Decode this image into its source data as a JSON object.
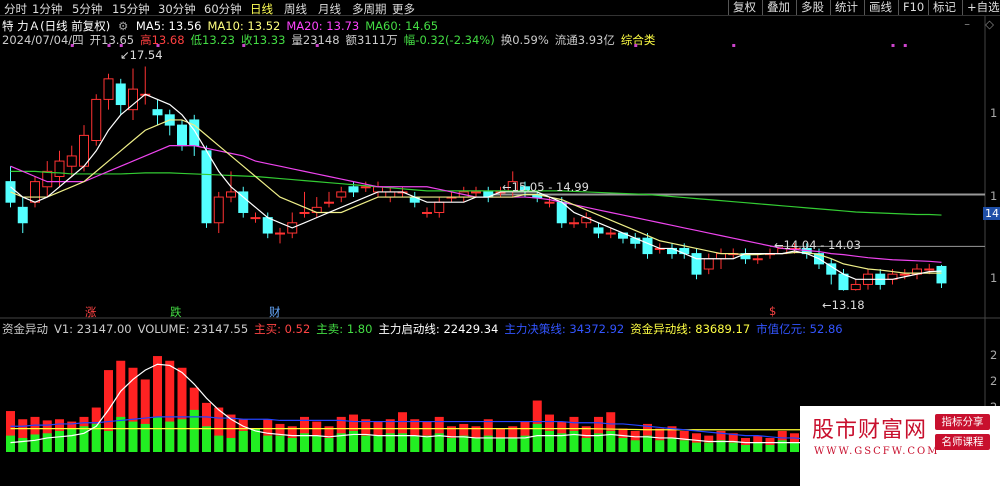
{
  "toolbar": {
    "periods": [
      "分时",
      "1分钟",
      "5分钟",
      "15分钟",
      "30分钟",
      "60分钟",
      "日线",
      "周线",
      "月线",
      "多周期",
      "更多"
    ],
    "active_period": "日线",
    "right_buttons": [
      "复权",
      "叠加",
      "多股",
      "统计",
      "画线",
      "F10",
      "标记",
      "+自选"
    ]
  },
  "main_panel": {
    "stock_title": "特 力Ａ(日线 前复权)",
    "ma_labels": [
      {
        "text": "MA5: 13.56",
        "color": "#ffffff"
      },
      {
        "text": "MA10: 13.52",
        "color": "#ffff7f"
      },
      {
        "text": "MA20: 13.73",
        "color": "#ff44ff"
      },
      {
        "text": "MA60: 14.65",
        "color": "#44dd44"
      }
    ],
    "quote_line": [
      {
        "text": "2024/07/04/四",
        "color": "#cccccc"
      },
      {
        "text": "开13.65",
        "color": "#cccccc"
      },
      {
        "text": "高13.68",
        "color": "#ff4040"
      },
      {
        "text": "低13.23",
        "color": "#44dd44"
      },
      {
        "text": "收13.33",
        "color": "#44dd44"
      },
      {
        "text": "量23148",
        "color": "#cccccc"
      },
      {
        "text": "额3111万",
        "color": "#cccccc"
      },
      {
        "text": "幅-0.32(-2.34%)",
        "color": "#44dd44"
      },
      {
        "text": "换0.59%",
        "color": "#cccccc"
      },
      {
        "text": "流通3.93亿",
        "color": "#cccccc"
      },
      {
        "text": "综合类",
        "color": "#ffff44"
      }
    ],
    "annotations": {
      "high": "17.54",
      "low": "13.18",
      "range1": "15.05 - 14.99",
      "range2": "14.04 - 14.03"
    },
    "right_price_tag": "14.",
    "axis_ticks": [
      "1",
      "1",
      "1"
    ],
    "event_markers": [
      {
        "text": "涨",
        "color": "#ff4444"
      },
      {
        "text": "跌",
        "color": "#44dd44"
      },
      {
        "text": "财",
        "color": "#66aaff"
      },
      {
        "text": "$",
        "color": "#ff4444"
      }
    ]
  },
  "sub_panel": {
    "labels": [
      {
        "text": "资金异动",
        "color": "#cccccc"
      },
      {
        "text": "V1: 23147.00",
        "color": "#cccccc"
      },
      {
        "text": "VOLUME: 23147.55",
        "color": "#cccccc"
      },
      {
        "text": "主买: 0.52",
        "color": "#ff4444"
      },
      {
        "text": "主卖: 1.80",
        "color": "#44dd44"
      },
      {
        "text": "主力启动线: 22429.34",
        "color": "#ffffff"
      },
      {
        "text": "主力决策线: 34372.92",
        "color": "#3355ff"
      },
      {
        "text": "资金异动线: 83689.17",
        "color": "#ffff44"
      },
      {
        "text": "市值亿元: 52.86",
        "color": "#3355ff"
      }
    ],
    "axis_ticks": [
      "2",
      "2",
      "2",
      "1"
    ]
  },
  "watermark": {
    "brand": "股市财富网",
    "url": "WWW.GSCFW.COM",
    "tag1": "指标分享",
    "tag2": "名师课程"
  },
  "chart_data": {
    "type": "candlestick",
    "candles": [
      {
        "o": 15.3,
        "c": 14.9,
        "h": 15.6,
        "l": 14.8
      },
      {
        "o": 14.8,
        "c": 14.5,
        "h": 15.0,
        "l": 14.3
      },
      {
        "o": 14.9,
        "c": 15.3,
        "h": 15.4,
        "l": 14.8
      },
      {
        "o": 15.2,
        "c": 15.5,
        "h": 15.7,
        "l": 15.0
      },
      {
        "o": 15.4,
        "c": 15.7,
        "h": 15.9,
        "l": 15.2
      },
      {
        "o": 15.6,
        "c": 15.8,
        "h": 16.0,
        "l": 15.4
      },
      {
        "o": 15.6,
        "c": 16.2,
        "h": 16.4,
        "l": 15.5
      },
      {
        "o": 16.1,
        "c": 16.9,
        "h": 17.0,
        "l": 16.0
      },
      {
        "o": 16.9,
        "c": 17.3,
        "h": 17.4,
        "l": 16.7
      },
      {
        "o": 17.2,
        "c": 16.8,
        "h": 17.3,
        "l": 16.6
      },
      {
        "o": 16.7,
        "c": 17.1,
        "h": 17.5,
        "l": 16.5
      },
      {
        "o": 17.0,
        "c": 17.0,
        "h": 17.54,
        "l": 16.8
      },
      {
        "o": 16.7,
        "c": 16.6,
        "h": 16.9,
        "l": 16.4
      },
      {
        "o": 16.6,
        "c": 16.4,
        "h": 16.7,
        "l": 16.2
      },
      {
        "o": 16.4,
        "c": 16.0,
        "h": 16.5,
        "l": 15.9
      },
      {
        "o": 16.5,
        "c": 16.0,
        "h": 16.6,
        "l": 15.8
      },
      {
        "o": 15.9,
        "c": 14.5,
        "h": 16.0,
        "l": 14.4
      },
      {
        "o": 14.5,
        "c": 15.0,
        "h": 15.1,
        "l": 14.3
      },
      {
        "o": 15.0,
        "c": 15.1,
        "h": 15.5,
        "l": 14.9
      },
      {
        "o": 15.1,
        "c": 14.7,
        "h": 15.2,
        "l": 14.6
      },
      {
        "o": 14.6,
        "c": 14.6,
        "h": 14.7,
        "l": 14.5
      },
      {
        "o": 14.6,
        "c": 14.3,
        "h": 14.7,
        "l": 14.2
      },
      {
        "o": 14.3,
        "c": 14.3,
        "h": 14.4,
        "l": 14.1
      },
      {
        "o": 14.3,
        "c": 14.5,
        "h": 14.7,
        "l": 14.2
      },
      {
        "o": 14.7,
        "c": 14.7,
        "h": 15.1,
        "l": 14.6
      },
      {
        "o": 14.7,
        "c": 14.8,
        "h": 15.0,
        "l": 14.6
      },
      {
        "o": 14.9,
        "c": 14.9,
        "h": 15.1,
        "l": 14.8
      },
      {
        "o": 15.0,
        "c": 15.1,
        "h": 15.2,
        "l": 14.9
      },
      {
        "o": 15.2,
        "c": 15.1,
        "h": 15.3,
        "l": 15.0
      },
      {
        "o": 15.2,
        "c": 15.2,
        "h": 15.3,
        "l": 15.1
      },
      {
        "o": 15.1,
        "c": 15.2,
        "h": 15.3,
        "l": 15.0
      },
      {
        "o": 15.0,
        "c": 15.1,
        "h": 15.2,
        "l": 14.9
      },
      {
        "o": 15.1,
        "c": 15.1,
        "h": 15.2,
        "l": 15.0
      },
      {
        "o": 15.0,
        "c": 14.9,
        "h": 15.1,
        "l": 14.8
      },
      {
        "o": 14.7,
        "c": 14.7,
        "h": 14.8,
        "l": 14.6
      },
      {
        "o": 14.7,
        "c": 14.9,
        "h": 15.0,
        "l": 14.6
      },
      {
        "o": 15.0,
        "c": 15.0,
        "h": 15.1,
        "l": 14.9
      },
      {
        "o": 15.0,
        "c": 15.1,
        "h": 15.2,
        "l": 14.9
      },
      {
        "o": 15.1,
        "c": 15.1,
        "h": 15.2,
        "l": 15.0
      },
      {
        "o": 15.1,
        "c": 15.0,
        "h": 15.2,
        "l": 14.9
      },
      {
        "o": 15.1,
        "c": 15.1,
        "h": 15.2,
        "l": 15.0
      },
      {
        "o": 15.1,
        "c": 15.3,
        "h": 15.5,
        "l": 15.0
      },
      {
        "o": 15.2,
        "c": 15.1,
        "h": 15.3,
        "l": 15.0
      },
      {
        "o": 15.05,
        "c": 14.99,
        "h": 15.1,
        "l": 14.9
      },
      {
        "o": 14.9,
        "c": 14.9,
        "h": 15.0,
        "l": 14.8
      },
      {
        "o": 14.9,
        "c": 14.5,
        "h": 15.0,
        "l": 14.4
      },
      {
        "o": 14.5,
        "c": 14.5,
        "h": 14.6,
        "l": 14.4
      },
      {
        "o": 14.5,
        "c": 14.6,
        "h": 14.7,
        "l": 14.4
      },
      {
        "o": 14.4,
        "c": 14.3,
        "h": 14.5,
        "l": 14.2
      },
      {
        "o": 14.3,
        "c": 14.3,
        "h": 14.4,
        "l": 14.2
      },
      {
        "o": 14.3,
        "c": 14.2,
        "h": 14.3,
        "l": 14.1
      },
      {
        "o": 14.2,
        "c": 14.1,
        "h": 14.3,
        "l": 14.0
      },
      {
        "o": 14.2,
        "c": 13.9,
        "h": 14.3,
        "l": 13.8
      },
      {
        "o": 14.0,
        "c": 14.0,
        "h": 14.1,
        "l": 13.9
      },
      {
        "o": 14.0,
        "c": 13.9,
        "h": 14.1,
        "l": 13.8
      },
      {
        "o": 14.0,
        "c": 13.9,
        "h": 14.1,
        "l": 13.8
      },
      {
        "o": 13.9,
        "c": 13.5,
        "h": 14.0,
        "l": 13.4
      },
      {
        "o": 13.6,
        "c": 13.8,
        "h": 13.9,
        "l": 13.5
      },
      {
        "o": 13.8,
        "c": 13.9,
        "h": 14.0,
        "l": 13.6
      },
      {
        "o": 13.9,
        "c": 13.9,
        "h": 14.0,
        "l": 13.8
      },
      {
        "o": 13.9,
        "c": 13.8,
        "h": 14.0,
        "l": 13.7
      },
      {
        "o": 13.8,
        "c": 13.8,
        "h": 13.9,
        "l": 13.7
      },
      {
        "o": 13.9,
        "c": 13.9,
        "h": 14.0,
        "l": 13.8
      },
      {
        "o": 13.9,
        "c": 14.0,
        "h": 14.04,
        "l": 13.9
      },
      {
        "o": 14.0,
        "c": 14.0,
        "h": 14.1,
        "l": 13.9
      },
      {
        "o": 14.0,
        "c": 13.9,
        "h": 14.1,
        "l": 13.8
      },
      {
        "o": 13.9,
        "c": 13.7,
        "h": 14.0,
        "l": 13.6
      },
      {
        "o": 13.7,
        "c": 13.5,
        "h": 13.8,
        "l": 13.3
      },
      {
        "o": 13.5,
        "c": 13.2,
        "h": 13.6,
        "l": 13.18
      },
      {
        "o": 13.2,
        "c": 13.3,
        "h": 13.4,
        "l": 13.18
      },
      {
        "o": 13.3,
        "c": 13.5,
        "h": 13.6,
        "l": 13.2
      },
      {
        "o": 13.5,
        "c": 13.3,
        "h": 13.6,
        "l": 13.2
      },
      {
        "o": 13.4,
        "c": 13.5,
        "h": 13.6,
        "l": 13.3
      },
      {
        "o": 13.5,
        "c": 13.5,
        "h": 13.6,
        "l": 13.4
      },
      {
        "o": 13.5,
        "c": 13.6,
        "h": 13.7,
        "l": 13.4
      },
      {
        "o": 13.6,
        "c": 13.6,
        "h": 13.7,
        "l": 13.5
      },
      {
        "o": 13.65,
        "c": 13.33,
        "h": 13.68,
        "l": 13.23
      }
    ],
    "ma5": [
      15.2,
      15.0,
      14.9,
      15.0,
      15.2,
      15.4,
      15.6,
      15.9,
      16.3,
      16.6,
      16.8,
      17.0,
      16.9,
      16.8,
      16.6,
      16.3,
      15.9,
      15.5,
      15.2,
      15.0,
      14.8,
      14.6,
      14.5,
      14.4,
      14.5,
      14.6,
      14.7,
      14.8,
      14.9,
      15.0,
      15.1,
      15.1,
      15.1,
      15.0,
      14.9,
      14.9,
      14.9,
      14.9,
      15.0,
      15.0,
      15.1,
      15.1,
      15.1,
      15.1,
      15.0,
      14.9,
      14.7,
      14.6,
      14.5,
      14.4,
      14.3,
      14.2,
      14.1,
      14.0,
      14.0,
      13.9,
      13.8,
      13.8,
      13.8,
      13.8,
      13.9,
      13.9,
      13.9,
      13.9,
      13.95,
      13.9,
      13.8,
      13.65,
      13.5,
      13.4,
      13.4,
      13.4,
      13.4,
      13.45,
      13.5,
      13.55,
      13.56
    ],
    "ma10": [
      15.1,
      15.0,
      15.0,
      15.0,
      15.1,
      15.2,
      15.3,
      15.5,
      15.7,
      15.9,
      16.1,
      16.3,
      16.4,
      16.5,
      16.5,
      16.4,
      16.2,
      16.0,
      15.8,
      15.6,
      15.4,
      15.2,
      15.0,
      14.9,
      14.8,
      14.7,
      14.7,
      14.7,
      14.8,
      14.9,
      15.0,
      15.0,
      15.0,
      15.0,
      15.0,
      15.0,
      15.0,
      15.0,
      15.0,
      15.0,
      15.0,
      15.0,
      15.05,
      15.05,
      15.0,
      14.95,
      14.85,
      14.75,
      14.65,
      14.55,
      14.45,
      14.35,
      14.25,
      14.15,
      14.1,
      14.05,
      14.0,
      13.95,
      13.9,
      13.9,
      13.88,
      13.88,
      13.9,
      13.9,
      13.92,
      13.92,
      13.88,
      13.8,
      13.7,
      13.65,
      13.6,
      13.58,
      13.55,
      13.52,
      13.52,
      13.52,
      13.52
    ],
    "ma20": [
      15.6,
      15.5,
      15.4,
      15.3,
      15.3,
      15.3,
      15.3,
      15.4,
      15.5,
      15.6,
      15.7,
      15.8,
      15.9,
      16.0,
      16.0,
      16.0,
      15.95,
      15.9,
      15.85,
      15.8,
      15.7,
      15.65,
      15.6,
      15.55,
      15.5,
      15.45,
      15.4,
      15.35,
      15.3,
      15.25,
      15.2,
      15.2,
      15.2,
      15.2,
      15.2,
      15.15,
      15.1,
      15.05,
      15.0,
      15.0,
      15.0,
      15.0,
      15.0,
      14.98,
      14.95,
      14.9,
      14.85,
      14.8,
      14.75,
      14.7,
      14.65,
      14.6,
      14.55,
      14.5,
      14.45,
      14.4,
      14.35,
      14.3,
      14.25,
      14.2,
      14.15,
      14.1,
      14.05,
      14.0,
      13.98,
      13.96,
      13.94,
      13.9,
      13.88,
      13.85,
      13.82,
      13.8,
      13.78,
      13.77,
      13.76,
      13.75,
      13.73
    ],
    "ma60": [
      15.5,
      15.5,
      15.5,
      15.48,
      15.47,
      15.45,
      15.45,
      15.45,
      15.45,
      15.45,
      15.46,
      15.47,
      15.47,
      15.47,
      15.46,
      15.45,
      15.44,
      15.43,
      15.42,
      15.41,
      15.4,
      15.38,
      15.36,
      15.34,
      15.32,
      15.3,
      15.28,
      15.26,
      15.24,
      15.22,
      15.2,
      15.18,
      15.16,
      15.14,
      15.12,
      15.12,
      15.12,
      15.12,
      15.12,
      15.12,
      15.12,
      15.12,
      15.12,
      15.12,
      15.12,
      15.12,
      15.11,
      15.1,
      15.09,
      15.08,
      15.07,
      15.06,
      15.05,
      15.03,
      15.01,
      14.99,
      14.97,
      14.95,
      14.93,
      14.91,
      14.89,
      14.87,
      14.85,
      14.83,
      14.81,
      14.79,
      14.77,
      14.75,
      14.73,
      14.71,
      14.7,
      14.69,
      14.68,
      14.67,
      14.66,
      14.66,
      14.65
    ],
    "ref_lines": [
      15.05,
      14.04
    ],
    "price_range": [
      12.9,
      17.9
    ],
    "sub_values": {
      "vol_red": [
        35,
        28,
        30,
        27,
        28,
        26,
        30,
        38,
        70,
        78,
        72,
        62,
        82,
        78,
        72,
        55,
        42,
        38,
        32,
        28,
        20,
        28,
        24,
        22,
        30,
        26,
        22,
        30,
        32,
        28,
        26,
        28,
        34,
        28,
        26,
        30,
        22,
        24,
        22,
        28,
        20,
        22,
        26,
        44,
        32,
        26,
        30,
        22,
        30,
        34,
        20,
        18,
        24,
        20,
        22,
        18,
        16,
        14,
        18,
        16,
        12,
        14,
        12,
        18,
        16,
        14,
        12,
        10,
        14,
        12,
        10,
        12,
        10,
        8,
        10,
        10,
        8
      ],
      "vol_green": [
        14,
        12,
        15,
        16,
        18,
        20,
        22,
        24,
        18,
        30,
        26,
        24,
        30,
        26,
        28,
        36,
        22,
        14,
        12,
        18,
        20,
        14,
        14,
        12,
        16,
        14,
        12,
        16,
        18,
        14,
        14,
        16,
        16,
        14,
        14,
        16,
        12,
        14,
        12,
        14,
        12,
        12,
        14,
        24,
        18,
        16,
        18,
        12,
        16,
        18,
        12,
        10,
        14,
        10,
        12,
        10,
        8,
        8,
        10,
        8,
        6,
        8,
        6,
        10,
        8,
        8,
        6,
        6,
        8,
        6,
        6,
        6,
        6,
        4,
        6,
        6,
        4
      ],
      "white_line": [
        8,
        9,
        10,
        12,
        13,
        14,
        16,
        22,
        36,
        52,
        62,
        70,
        75,
        74,
        68,
        58,
        46,
        36,
        28,
        22,
        18,
        16,
        15,
        14,
        14,
        14,
        13,
        14,
        15,
        15,
        14,
        14,
        14,
        14,
        13,
        14,
        13,
        13,
        12,
        12,
        12,
        12,
        12,
        14,
        14,
        14,
        15,
        14,
        14,
        15,
        14,
        13,
        13,
        12,
        12,
        11,
        10,
        9,
        9,
        9,
        8,
        8,
        8,
        8,
        8,
        8,
        7,
        7,
        7,
        6,
        6,
        6,
        6,
        6,
        6,
        6,
        6
      ],
      "blue_line": [
        22,
        22,
        23,
        23,
        24,
        24,
        25,
        25,
        26,
        27,
        28,
        29,
        30,
        30,
        30,
        30,
        30,
        29,
        29,
        28,
        28,
        28,
        27,
        27,
        27,
        27,
        27,
        27,
        26,
        26,
        26,
        26,
        26,
        26,
        26,
        26,
        26,
        26,
        26,
        26,
        26,
        26,
        26,
        26,
        26,
        26,
        25,
        25,
        25,
        24,
        24,
        23,
        22,
        21,
        20,
        19,
        18,
        17,
        16,
        15,
        14,
        14,
        13,
        12,
        12,
        11,
        11,
        10,
        10,
        9,
        9,
        9,
        8,
        8,
        8,
        8,
        8
      ],
      "yellow_line": [
        20,
        20,
        20,
        20,
        20,
        20,
        20,
        20,
        20,
        20,
        20,
        20,
        20,
        20,
        20,
        20,
        20,
        20,
        20,
        20,
        20,
        20,
        20,
        20,
        20,
        20,
        20,
        20,
        20,
        20,
        20,
        20,
        20,
        20,
        20,
        20,
        20,
        20,
        20,
        20,
        20,
        20,
        20,
        20,
        20,
        20,
        20,
        20,
        19.8,
        19.6,
        19.4,
        19.2,
        19,
        19,
        19,
        19,
        19,
        19,
        19,
        19,
        19,
        19,
        19,
        19,
        19,
        19,
        19,
        19,
        19,
        19,
        19,
        19,
        19,
        19,
        19,
        19,
        19
      ],
      "range": [
        0,
        100
      ]
    }
  }
}
